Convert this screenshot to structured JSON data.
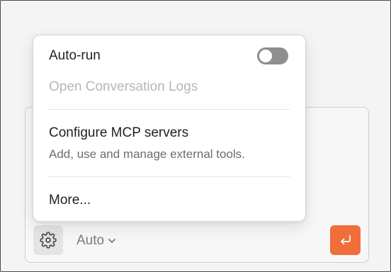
{
  "menu": {
    "autorun_label": "Auto-run",
    "autorun_enabled": false,
    "logs_label": "Open Conversation Logs",
    "mcp_label": "Configure MCP servers",
    "mcp_description": "Add, use and manage external tools.",
    "more_label": "More..."
  },
  "toolbar": {
    "model_value": "Auto"
  },
  "icons": {
    "settings": "gear-icon",
    "model_caret": "chevron-down-icon",
    "send": "enter-return-icon"
  },
  "colors": {
    "send_button": "#f16e3a",
    "toggle_off": "#8e8e8e"
  }
}
